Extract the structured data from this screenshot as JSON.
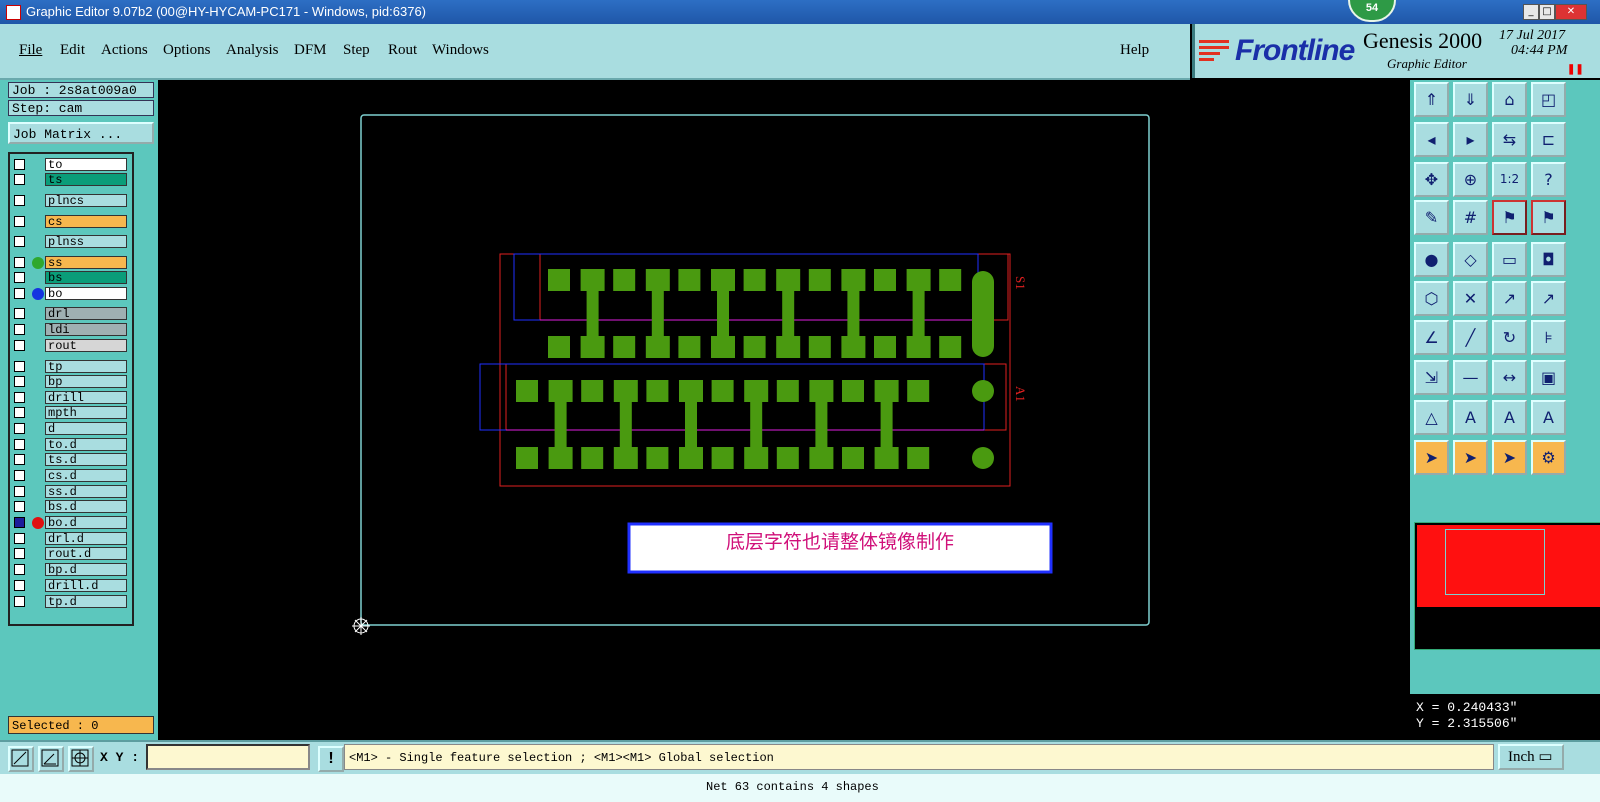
{
  "window": {
    "title": "Graphic Editor 9.07b2 (00@HY-HYCAM-PC171 - Windows, pid:6376)",
    "badge": "54"
  },
  "menu": {
    "items": [
      "File",
      "Edit",
      "Actions",
      "Options",
      "Analysis",
      "DFM",
      "Step",
      "Rout",
      "Windows"
    ],
    "help": "Help"
  },
  "brand": {
    "logo": "Frontline",
    "product": "Genesis 2000",
    "subtitle": "Graphic Editor",
    "date": "17 Jul 2017",
    "time": "04:44 PM"
  },
  "job": {
    "job_label": "Job : 2s8at009a0",
    "step_label": "Step: cam",
    "matrix_button": "Job Matrix ..."
  },
  "layers": [
    {
      "name": "to",
      "bg": "#ffffff",
      "dot": ""
    },
    {
      "name": "ts",
      "bg": "#0a9d79",
      "dot": ""
    },
    {
      "name": "plncs",
      "bg": "#a9dde0",
      "dot": ""
    },
    {
      "name": "cs",
      "bg": "#f7b74e",
      "dot": ""
    },
    {
      "name": "plnss",
      "bg": "#a9dde0",
      "dot": ""
    },
    {
      "name": "ss",
      "bg": "#f7b74e",
      "dot": "#2fa82f"
    },
    {
      "name": "bs",
      "bg": "#0a9d79",
      "dot": ""
    },
    {
      "name": "bo",
      "bg": "#ffffff",
      "dot": "#1434e0"
    },
    {
      "name": "drl",
      "bg": "#9fb0b2",
      "dot": ""
    },
    {
      "name": "ldi",
      "bg": "#9fb0b2",
      "dot": ""
    },
    {
      "name": "rout",
      "bg": "#d6d6d6",
      "dot": ""
    },
    {
      "name": "tp",
      "bg": "#a9dde0",
      "dot": ""
    },
    {
      "name": "bp",
      "bg": "#a9dde0",
      "dot": ""
    },
    {
      "name": "drill",
      "bg": "#a9dde0",
      "dot": ""
    },
    {
      "name": "mpth",
      "bg": "#a9dde0",
      "dot": ""
    },
    {
      "name": "d",
      "bg": "#a9dde0",
      "dot": ""
    },
    {
      "name": "to.d",
      "bg": "#a9dde0",
      "dot": ""
    },
    {
      "name": "ts.d",
      "bg": "#a9dde0",
      "dot": ""
    },
    {
      "name": "cs.d",
      "bg": "#a9dde0",
      "dot": ""
    },
    {
      "name": "ss.d",
      "bg": "#a9dde0",
      "dot": ""
    },
    {
      "name": "bs.d",
      "bg": "#a9dde0",
      "dot": ""
    },
    {
      "name": "bo.d",
      "bg": "#a9dde0",
      "dot": "#e01010"
    },
    {
      "name": "drl.d",
      "bg": "#a9dde0",
      "dot": ""
    },
    {
      "name": "rout.d",
      "bg": "#a9dde0",
      "dot": ""
    },
    {
      "name": "bp.d",
      "bg": "#a9dde0",
      "dot": ""
    },
    {
      "name": "drill.d",
      "bg": "#a9dde0",
      "dot": ""
    },
    {
      "name": "tp.d",
      "bg": "#a9dde0",
      "dot": ""
    }
  ],
  "selected": "Selected : 0",
  "canvas": {
    "note": "底层字符也请整体镜像制作",
    "label_upper": "S1",
    "label_lower": "A1",
    "colors": {
      "pad": "#4a9a10",
      "outline": "#7fd0d0",
      "red": "#e02020",
      "blue": "#2030ff",
      "magenta": "#e020e0",
      "note_text": "#d0107a"
    }
  },
  "coords": {
    "x": "X = 0.240433\"",
    "y": "Y = 2.315506\""
  },
  "toolbar_icons": [
    "page-up-icon",
    "page-down-icon",
    "home-icon",
    "zoom-window-icon",
    "pan-left-icon",
    "pan-right-icon",
    "flip-icon",
    "snap-icon",
    "zoom-fit-icon",
    "zoom-center-icon",
    "ratio-icon",
    "help-icon",
    "measure-options-icon",
    "grid-icon",
    "netlist-icon",
    "netlist-alt-icon",
    "add-pad-icon",
    "polygon-icon",
    "ruler-icon",
    "dashed-select-icon",
    "connect-icon",
    "delete-point-icon",
    "move-point-icon",
    "move-point-alt-icon",
    "line-icon",
    "line-alt-icon",
    "arc-icon",
    "text-fit-icon",
    "measure-icon",
    "line-segment-icon",
    "distance-icon",
    "pad-group-icon",
    "triangle-icon",
    "triangle-outline-icon",
    "text-icon",
    "text-mirror-icon",
    "select-pointer-icon",
    "select-box-icon",
    "select-box-alt-icon",
    "network-icon"
  ],
  "ratio_label": "1:2",
  "bottom": {
    "xy_label": "X Y :",
    "xy_value": "",
    "hint": "<M1> - Single feature selection ; <M1><M1> Global selection",
    "units": "Inch",
    "status": "Net 63 contains 4 shapes"
  }
}
